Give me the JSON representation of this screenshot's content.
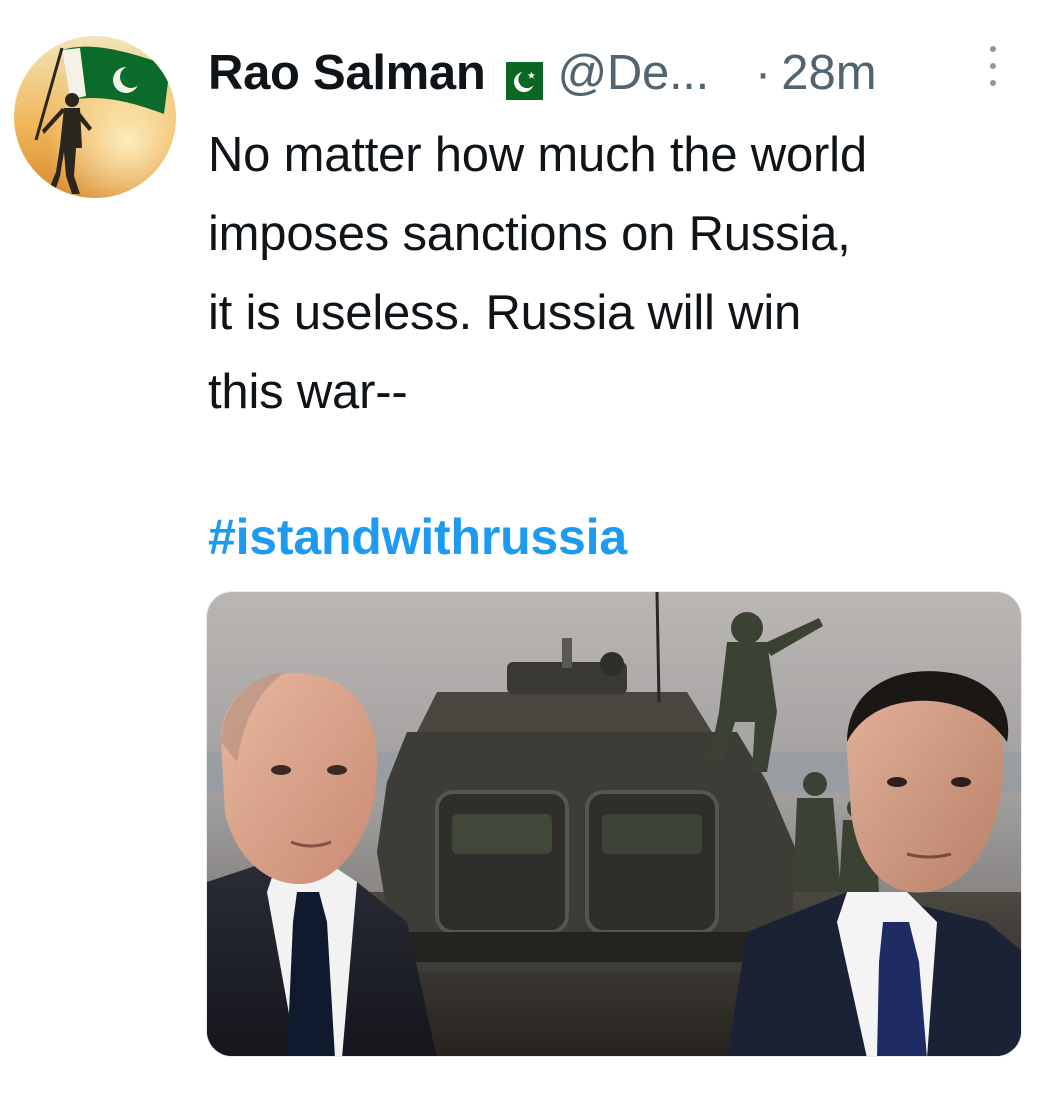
{
  "tweet": {
    "author_name": "Rao Salman",
    "flag_icon": "pakistan-flag-icon",
    "handle": "@De...",
    "separator": "·",
    "time": "28m",
    "text": "No matter how much the world\nimposes sanctions on Russia,\nit is useless. Russia will win\nthis war--",
    "hashtag": "#istandwithrussia",
    "colors": {
      "hashtag": "#1d9bf0",
      "secondary_text": "#536471",
      "flag_green": "#0b6623"
    }
  }
}
